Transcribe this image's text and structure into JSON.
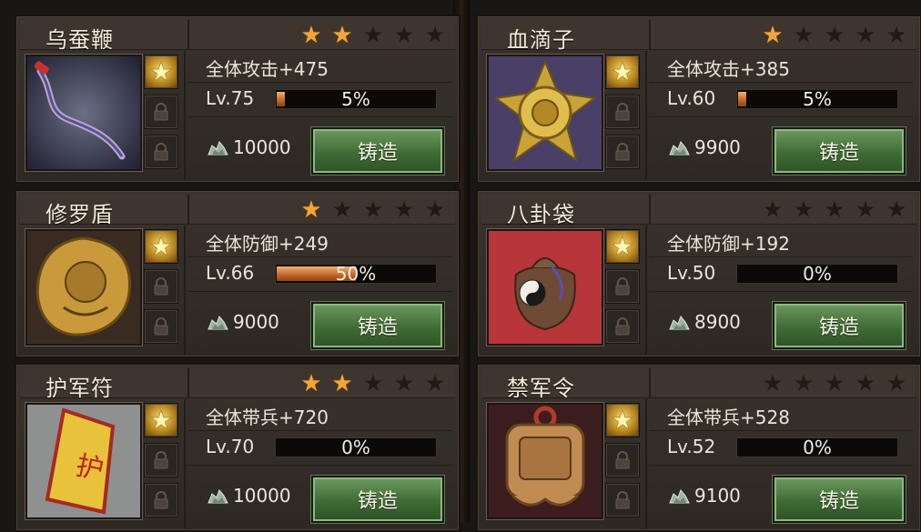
{
  "cards": [
    {
      "name": "乌蚕鞭",
      "stars": 2,
      "stat": "全体攻击+475",
      "level": "Lv.75",
      "progress": 5,
      "progress_label": "5%",
      "cost": "10000",
      "button": "铸造",
      "art": "whip-icon"
    },
    {
      "name": "血滴子",
      "stars": 1,
      "stat": "全体攻击+385",
      "level": "Lv.60",
      "progress": 5,
      "progress_label": "5%",
      "cost": "9900",
      "button": "铸造",
      "art": "blood-drop-weapon-icon"
    },
    {
      "name": "修罗盾",
      "stars": 1,
      "stat": "全体防御+249",
      "level": "Lv.66",
      "progress": 50,
      "progress_label": "50%",
      "cost": "9000",
      "button": "铸造",
      "art": "shield-icon"
    },
    {
      "name": "八卦袋",
      "stars": 0,
      "stat": "全体防御+192",
      "level": "Lv.50",
      "progress": 0,
      "progress_label": "0%",
      "cost": "8900",
      "button": "铸造",
      "art": "bagua-bag-icon"
    },
    {
      "name": "护军符",
      "stars": 2,
      "stat": "全体带兵+720",
      "level": "Lv.70",
      "progress": 0,
      "progress_label": "0%",
      "cost": "10000",
      "button": "铸造",
      "art": "talisman-icon"
    },
    {
      "name": "禁军令",
      "stars": 0,
      "stat": "全体带兵+528",
      "level": "Lv.52",
      "progress": 0,
      "progress_label": "0%",
      "cost": "9100",
      "button": "铸造",
      "art": "command-token-icon"
    }
  ],
  "max_stars": 5,
  "colors": {
    "star_on": "#f3a53a",
    "button": "#4f7c44",
    "progress": "#c06528"
  },
  "currency_icon": "silver-ore-icon"
}
